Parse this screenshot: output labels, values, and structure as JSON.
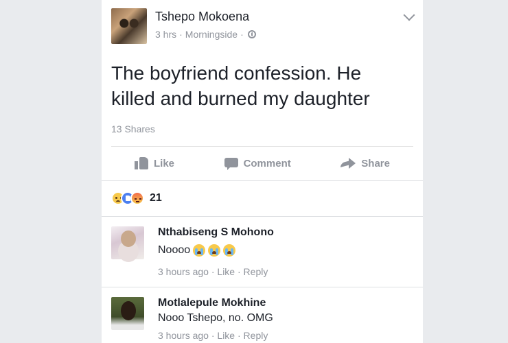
{
  "post": {
    "author": "Tshepo Mokoena",
    "time": "3 hrs",
    "location": "Morningside",
    "text": "The boyfriend confession. He\nkilled and burned my daughter",
    "shares": "13 Shares"
  },
  "actions": {
    "like": "Like",
    "comment": "Comment",
    "share": "Share"
  },
  "reactions": {
    "count": "21",
    "types": [
      "sad",
      "like",
      "angry"
    ]
  },
  "comments": [
    {
      "name": "Nthabiseng S Mohono",
      "text": "Noooo",
      "emoji": [
        "crying-face",
        "crying-face",
        "crying-face"
      ],
      "time": "3 hours ago",
      "like": "Like",
      "reply": "Reply"
    },
    {
      "name": "Motlalepule Mokhine",
      "text": "Nooo Tshepo, no. OMG",
      "time": "3 hours ago",
      "like": "Like",
      "reply": "Reply"
    }
  ],
  "colors": {
    "background": "#e9ebee",
    "card": "#ffffff",
    "text": "#1d2129",
    "muted": "#90949c"
  }
}
